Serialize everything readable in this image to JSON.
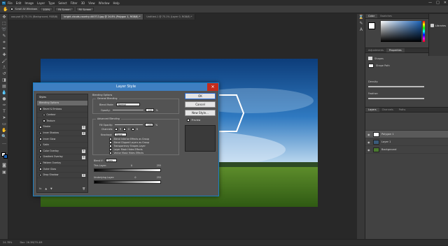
{
  "menubar": {
    "logo": "Ps",
    "items": [
      "File",
      "Edit",
      "Image",
      "Layer",
      "Type",
      "Select",
      "Filter",
      "3D",
      "View",
      "Window",
      "Help"
    ],
    "window_controls": [
      "—",
      "□",
      "✕"
    ]
  },
  "options_bar": {
    "scroll_all_label": "Scroll All Windows",
    "zoom_value": "100%",
    "fit_screen_label": "Fit Screen",
    "fill_screen_label": "Fill Screen"
  },
  "doc_tabs": [
    {
      "label": "ooo.psd @ 75.1% (Background, RGB/8)",
      "active": false
    },
    {
      "label": "bright-clouds-country-440713.jpg @ 24.8% (Polygon 1, RGB/8) *",
      "active": true
    },
    {
      "label": "Untitled-1 @ 75.1% (Layer 0, RGB/8) *",
      "active": false
    }
  ],
  "status_bar": {
    "zoom": "24.78%",
    "doc": "Doc: 26.3M/70.4M"
  },
  "color_panel": {
    "tabs": [
      "Color",
      "Swatches"
    ]
  },
  "libraries_label": "Libraries",
  "properties_panel": {
    "tabs": [
      "Adjustments",
      "Properties"
    ],
    "kind": "Shapes",
    "sub": "Shape Path",
    "density_label": "Density:",
    "feather_label": "Feather:"
  },
  "layers_panel": {
    "tabs": [
      "Layers",
      "Channels",
      "Paths"
    ],
    "layers": [
      {
        "name": "Polygon 1",
        "selected": true,
        "thumb": "#ffffff"
      },
      {
        "name": "Layer 1",
        "selected": false,
        "thumb": "#3b5b7a"
      },
      {
        "name": "Background",
        "selected": false,
        "thumb": "#4a7a2f"
      }
    ]
  },
  "dialog": {
    "title": "Layer Style",
    "close": "✕",
    "styles_header": "Styles",
    "blending_options": "Blending Options",
    "styles": [
      {
        "label": "Bevel & Emboss",
        "checkbox": true,
        "plus": false,
        "indent": false
      },
      {
        "label": "Contour",
        "checkbox": true,
        "plus": false,
        "indent": true
      },
      {
        "label": "Texture",
        "checkbox": true,
        "plus": false,
        "indent": true
      },
      {
        "label": "Stroke",
        "checkbox": true,
        "plus": true,
        "indent": false
      },
      {
        "label": "Inner Shadow",
        "checkbox": true,
        "plus": true,
        "indent": false
      },
      {
        "label": "Inner Glow",
        "checkbox": true,
        "plus": false,
        "indent": false
      },
      {
        "label": "Satin",
        "checkbox": true,
        "plus": false,
        "indent": false
      },
      {
        "label": "Color Overlay",
        "checkbox": true,
        "plus": true,
        "indent": false
      },
      {
        "label": "Gradient Overlay",
        "checkbox": true,
        "plus": true,
        "indent": false
      },
      {
        "label": "Pattern Overlay",
        "checkbox": true,
        "plus": false,
        "indent": false
      },
      {
        "label": "Outer Glow",
        "checkbox": true,
        "plus": false,
        "indent": false
      },
      {
        "label": "Drop Shadow",
        "checkbox": true,
        "plus": true,
        "indent": false
      }
    ],
    "footer_icons": [
      "fx",
      "▲",
      "▼",
      "🗑"
    ],
    "blend": {
      "section_title": "Blending Options",
      "general_title": "General Blending",
      "blend_mode_label": "Blend Mode:",
      "blend_mode_value": "Normal",
      "opacity_label": "Opacity:",
      "opacity_value": "100",
      "percent": "%",
      "advanced_title": "Advanced Blending",
      "fill_opacity_label": "Fill Opacity:",
      "fill_opacity_value": "100",
      "channels_label": "Channels:",
      "channel_r": "R",
      "channel_g": "G",
      "channel_b": "B",
      "knockout_label": "Knockout:",
      "knockout_value": "None",
      "options": [
        {
          "label": "Blend Interior Effects as Group",
          "checked": false
        },
        {
          "label": "Blend Clipped Layers as Group",
          "checked": true
        },
        {
          "label": "Transparency Shapes Layer",
          "checked": true
        },
        {
          "label": "Layer Mask Hides Effects",
          "checked": false
        },
        {
          "label": "Vector Mask Hides Effects",
          "checked": false
        }
      ],
      "blend_if_label": "Blend If:",
      "blend_if_value": "Gray",
      "this_layer_label": "This Layer:",
      "this_layer_min": "0",
      "this_layer_max": "255",
      "underlying_label": "Underlying Layer:",
      "underlying_min": "0",
      "underlying_max": "255"
    },
    "buttons": {
      "ok": "OK",
      "cancel": "Cancel",
      "new_style": "New Style...",
      "preview": "Preview"
    }
  }
}
